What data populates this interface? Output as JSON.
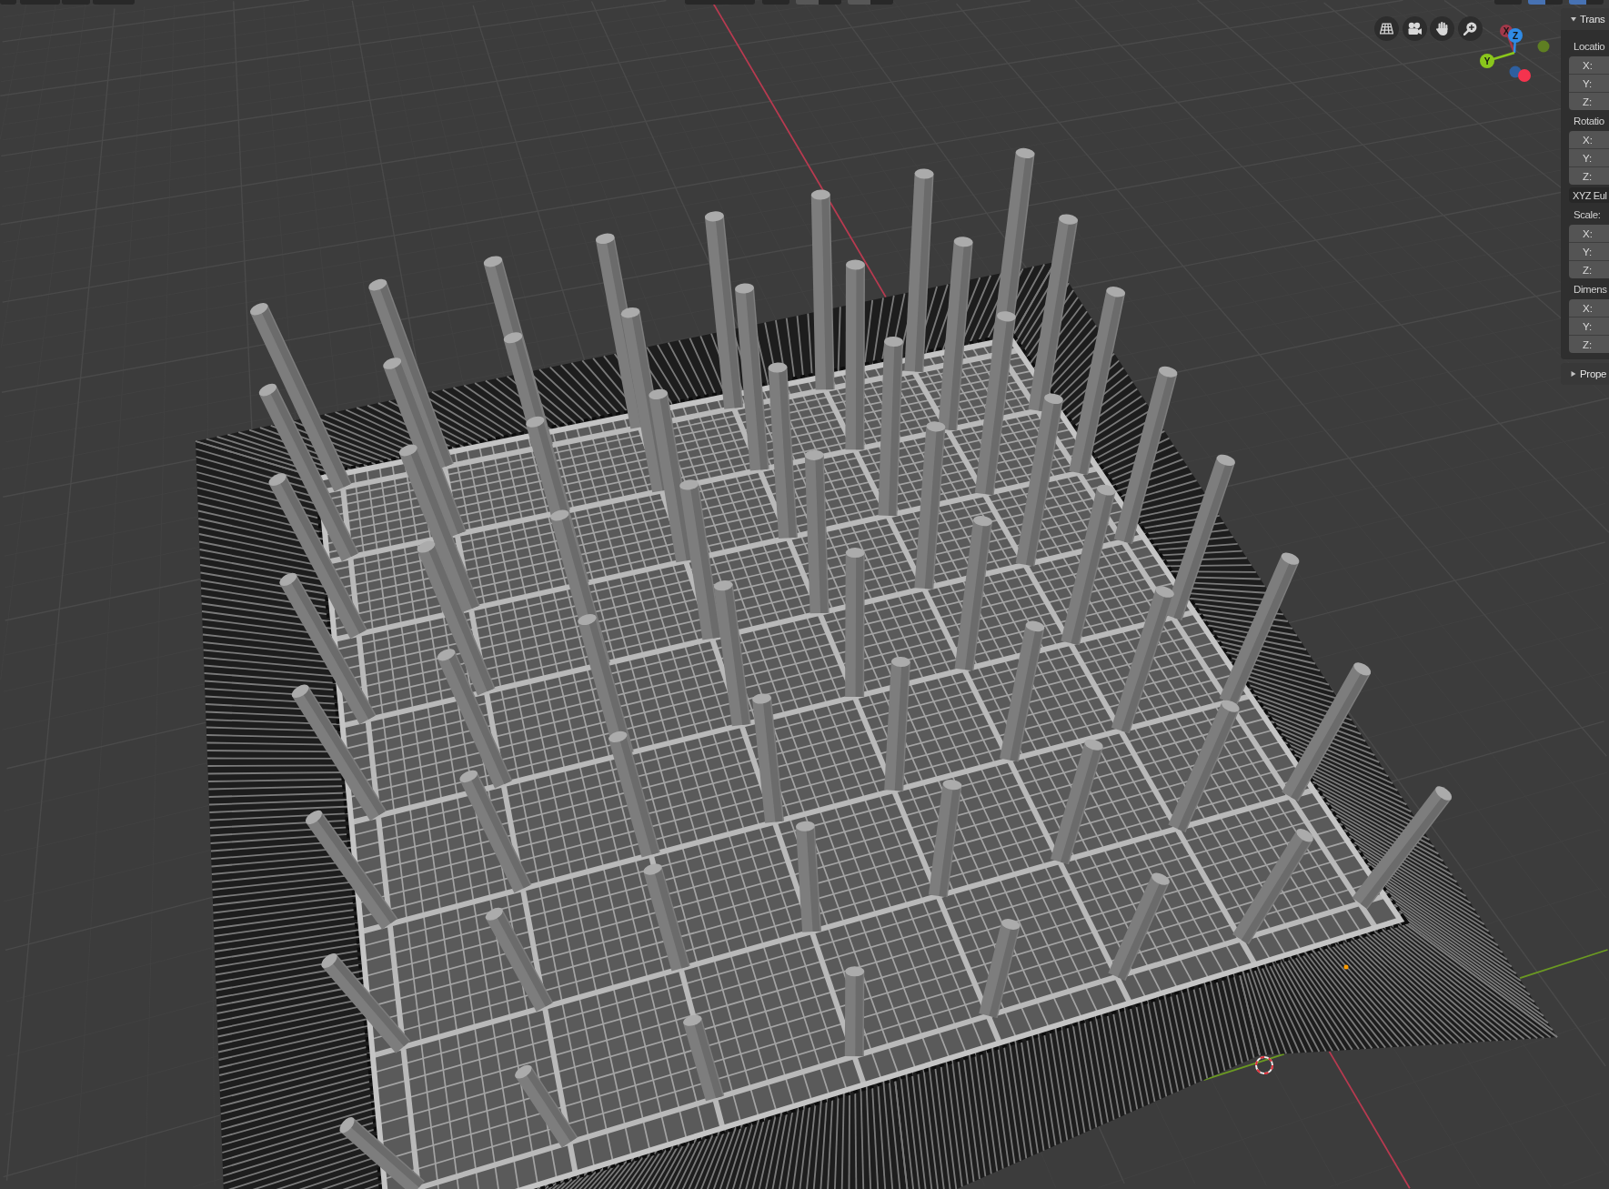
{
  "header": {
    "controls": [
      {
        "segments": [
          {
            "selected": false,
            "highlighted": false
          }
        ]
      },
      {
        "segments": [
          {
            "selected": false,
            "highlighted": false
          }
        ]
      },
      {
        "segments": [
          {
            "selected": false,
            "highlighted": false
          }
        ]
      },
      {
        "segments": [
          {
            "selected": false,
            "highlighted": false
          }
        ]
      },
      {
        "segments": [
          {
            "selected": false,
            "highlighted": false
          }
        ]
      },
      {
        "segments": [
          {
            "selected": false,
            "highlighted": false
          }
        ]
      },
      {
        "segments": [
          {
            "selected": false,
            "highlighted": true
          },
          {
            "selected": false,
            "highlighted": false
          }
        ]
      },
      {
        "segments": [
          {
            "selected": false,
            "highlighted": true
          },
          {
            "selected": false,
            "highlighted": false
          }
        ]
      },
      {
        "segments": [
          {
            "selected": false,
            "highlighted": false
          }
        ]
      },
      {
        "segments": [
          {
            "selected": true,
            "highlighted": false
          },
          {
            "selected": false,
            "highlighted": false
          }
        ]
      },
      {
        "segments": [
          {
            "selected": true,
            "highlighted": false
          },
          {
            "selected": false,
            "highlighted": false
          }
        ]
      }
    ]
  },
  "viewport": {
    "tools": [
      {
        "kind": "grid"
      },
      {
        "kind": "camera"
      },
      {
        "kind": "hand"
      },
      {
        "kind": "zoom"
      }
    ],
    "navigation_gizmo": {
      "axes": [
        {
          "label": "X",
          "color": "#a13849"
        },
        {
          "label": "Z",
          "color": "#2f8be6"
        },
        {
          "label": "Y",
          "color": "#8ac61c"
        }
      ],
      "negative_axes": [
        {
          "color": "#5f7f22"
        },
        {
          "color": "#2e5f9f"
        },
        {
          "color": "#f5334e"
        }
      ]
    }
  },
  "sidebar": {
    "panels": [
      {
        "title": "Trans",
        "expanded": true,
        "items": [
          {
            "kind": "vector",
            "label": "Locatio",
            "fields": [
              "X:",
              "Y:",
              "Z:"
            ]
          },
          {
            "kind": "vector",
            "label": "Rotatio",
            "fields": [
              "X:",
              "Y:",
              "Z:"
            ]
          },
          {
            "kind": "dropdown",
            "value": "XYZ Eul"
          },
          {
            "kind": "vector",
            "label": "Scale:",
            "fields": [
              "X:",
              "Y:",
              "Z:"
            ]
          },
          {
            "kind": "vector",
            "label": "Dimens",
            "fields": [
              "X:",
              "Y:",
              "Z:"
            ]
          }
        ]
      },
      {
        "title": "Prope",
        "expanded": false
      }
    ]
  }
}
